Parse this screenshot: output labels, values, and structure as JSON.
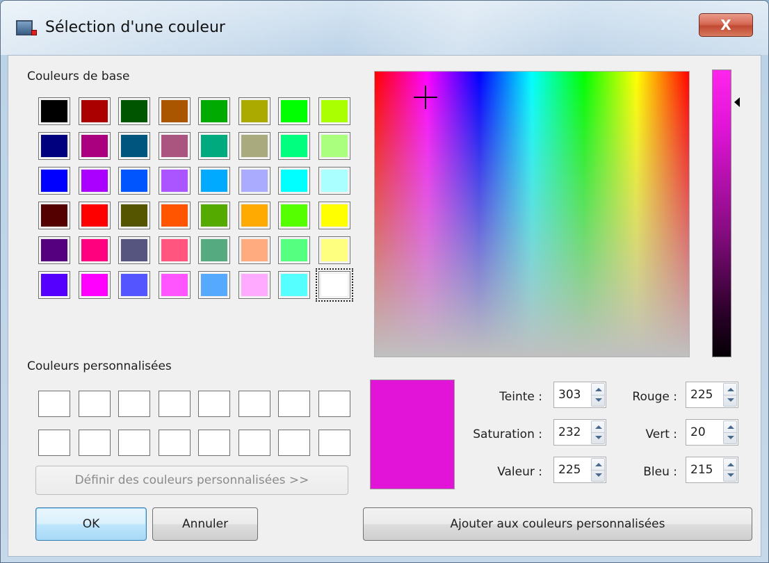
{
  "window": {
    "title": "Sélection d'une couleur",
    "close_label": "X"
  },
  "basic_colors": {
    "label": "Couleurs de base",
    "rows": [
      [
        "#000000",
        "#aa0000",
        "#005500",
        "#aa5500",
        "#00aa00",
        "#aaaa00",
        "#00ff00",
        "#aaff00"
      ],
      [
        "#00007f",
        "#aa007f",
        "#00557f",
        "#aa557f",
        "#00aa7f",
        "#aaaa7f",
        "#00ff7f",
        "#aaff7f"
      ],
      [
        "#0000ff",
        "#aa00ff",
        "#0055ff",
        "#aa55ff",
        "#00aaff",
        "#aaaaff",
        "#00ffff",
        "#aaffff"
      ],
      [
        "#550000",
        "#ff0000",
        "#555500",
        "#ff5500",
        "#55aa00",
        "#ffaa00",
        "#55ff00",
        "#ffff00"
      ],
      [
        "#55007f",
        "#ff007f",
        "#55557f",
        "#ff557f",
        "#55aa7f",
        "#ffaa7f",
        "#55ff7f",
        "#ffff7f"
      ],
      [
        "#5500ff",
        "#ff00ff",
        "#5555ff",
        "#ff55ff",
        "#55aaff",
        "#ffaaff",
        "#55ffff",
        "#ffffff"
      ]
    ],
    "selected": "#ffffff"
  },
  "custom_colors": {
    "label": "Couleurs personnalisées",
    "rows": [
      [
        "#ffffff",
        "#ffffff",
        "#ffffff",
        "#ffffff",
        "#ffffff",
        "#ffffff",
        "#ffffff",
        "#ffffff"
      ],
      [
        "#ffffff",
        "#ffffff",
        "#ffffff",
        "#ffffff",
        "#ffffff",
        "#ffffff",
        "#ffffff",
        "#ffffff"
      ]
    ],
    "define_button": "Définir des couleurs personnalisées >>"
  },
  "current_color": "#e114d7",
  "fields": {
    "hue_label": "Teinte :",
    "hue": "303",
    "saturation_label": "Saturation :",
    "saturation": "232",
    "value_label": "Valeur :",
    "value": "225",
    "red_label": "Rouge :",
    "red": "225",
    "green_label": "Vert :",
    "green": "20",
    "blue_label": "Bleu :",
    "blue": "215"
  },
  "buttons": {
    "ok": "OK",
    "cancel": "Annuler",
    "add_custom": "Ajouter aux couleurs personnalisées"
  },
  "icons": {
    "app": "app-window-icon",
    "close": "close-icon",
    "crosshair": "crosshair-icon",
    "value_arrow": "arrow-left-icon"
  }
}
